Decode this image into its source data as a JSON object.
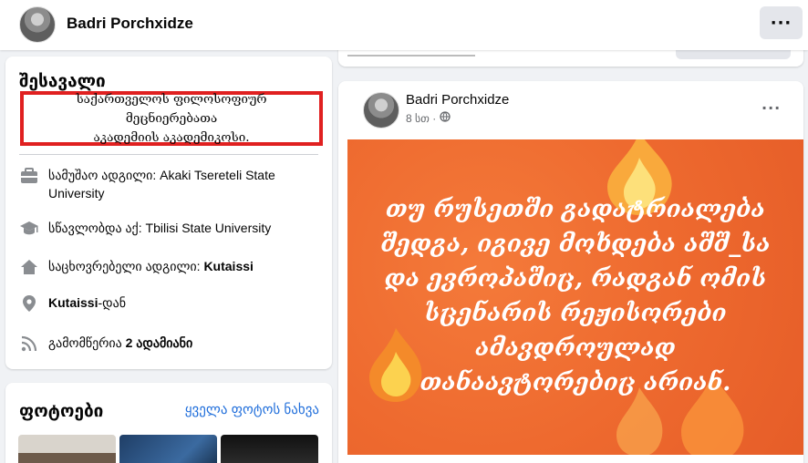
{
  "header": {
    "name": "Badri Porchxidze",
    "more_label": "···"
  },
  "intro": {
    "title": "შესავალი",
    "bio_lines": [
      "საქართველოს ფილოსოფიურ მეცნიერებათა",
      "აკადემიის აკადემიკოსი."
    ],
    "work_prefix": "სამუშაო ადგილი: ",
    "work_value": "Akaki Tsereteli State University",
    "study_prefix": "სწავლობდა აქ: ",
    "study_value": "Tbilisi State University",
    "home_prefix": "საცხოვრებელი ადგილი: ",
    "home_value": "Kutaissi",
    "from_value": "Kutaissi",
    "from_suffix": "-დან",
    "followers_prefix": "გამომწერია ",
    "followers_value": "2 ადამიანი"
  },
  "photos": {
    "title": "ფოტოები",
    "see_all": "ყველა ფოტოს ნახვა"
  },
  "post": {
    "author": "Badri Porchxidze",
    "time": "8 სთ ·",
    "privacy_icon": "globe-icon",
    "more_label": "···",
    "image_text_lines": [
      "თუ რუსეთში გადატრიალება",
      "შედგა, იგივე მოხდება აშშ_სა",
      "და ევროპაშიც, რადგან ომის",
      "სცენარის რეჟისორები",
      "ამავდროულად",
      "თანაავტორებიც არიან."
    ],
    "background_color": "#ee6a2f"
  },
  "colors": {
    "highlight_border": "#e02020",
    "link": "#216fdb"
  }
}
